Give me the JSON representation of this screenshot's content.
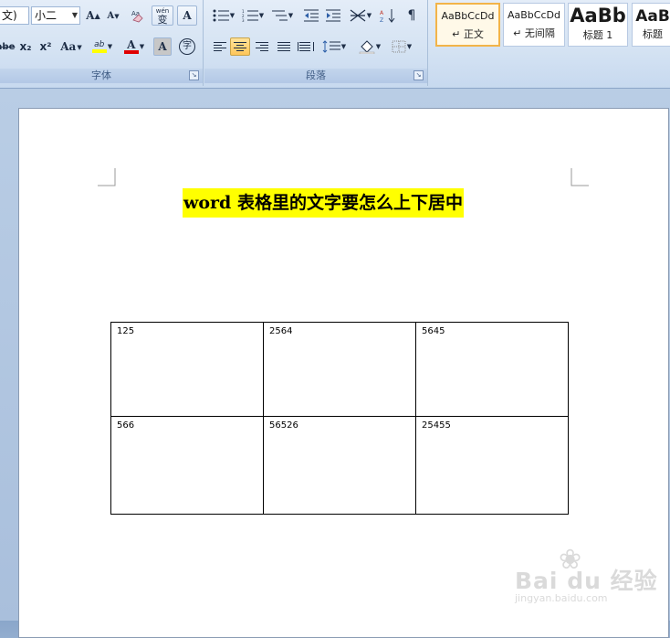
{
  "ribbon": {
    "font_group": {
      "label": "字体",
      "font_name_partial": "文)",
      "font_size": "小二",
      "grow_font": "A",
      "shrink_font": "A",
      "phonetic": "wén",
      "phonetic_char": "变",
      "char_border": "A",
      "strikethrough": "abe",
      "subscript": "x₂",
      "superscript": "x²",
      "change_case": "Aa",
      "highlight": "ab",
      "font_color": "A",
      "char_shading": "A",
      "enclose_char": "字"
    },
    "paragraph_group": {
      "label": "段落"
    },
    "styles": [
      {
        "preview": "AaBbCcDd",
        "name": "↵ 正文",
        "selected": true
      },
      {
        "preview": "AaBbCcDd",
        "name": "↵ 无间隔",
        "selected": false
      },
      {
        "preview": "AaBb",
        "name": "标题 1",
        "selected": false
      },
      {
        "preview": "AaB",
        "name": "标题",
        "selected": false
      }
    ]
  },
  "document": {
    "title": "word 表格里的文字要怎么上下居中",
    "table": [
      [
        "125",
        "2564",
        "5645"
      ],
      [
        "566",
        "56526",
        "25455"
      ]
    ]
  },
  "watermark": {
    "main": "Bai du 经验",
    "sub": "jingyan.baidu.com"
  },
  "colors": {
    "highlight": "#ffff00",
    "font_color_bar": "#e00000",
    "selected_style_border": "#f2b449"
  }
}
